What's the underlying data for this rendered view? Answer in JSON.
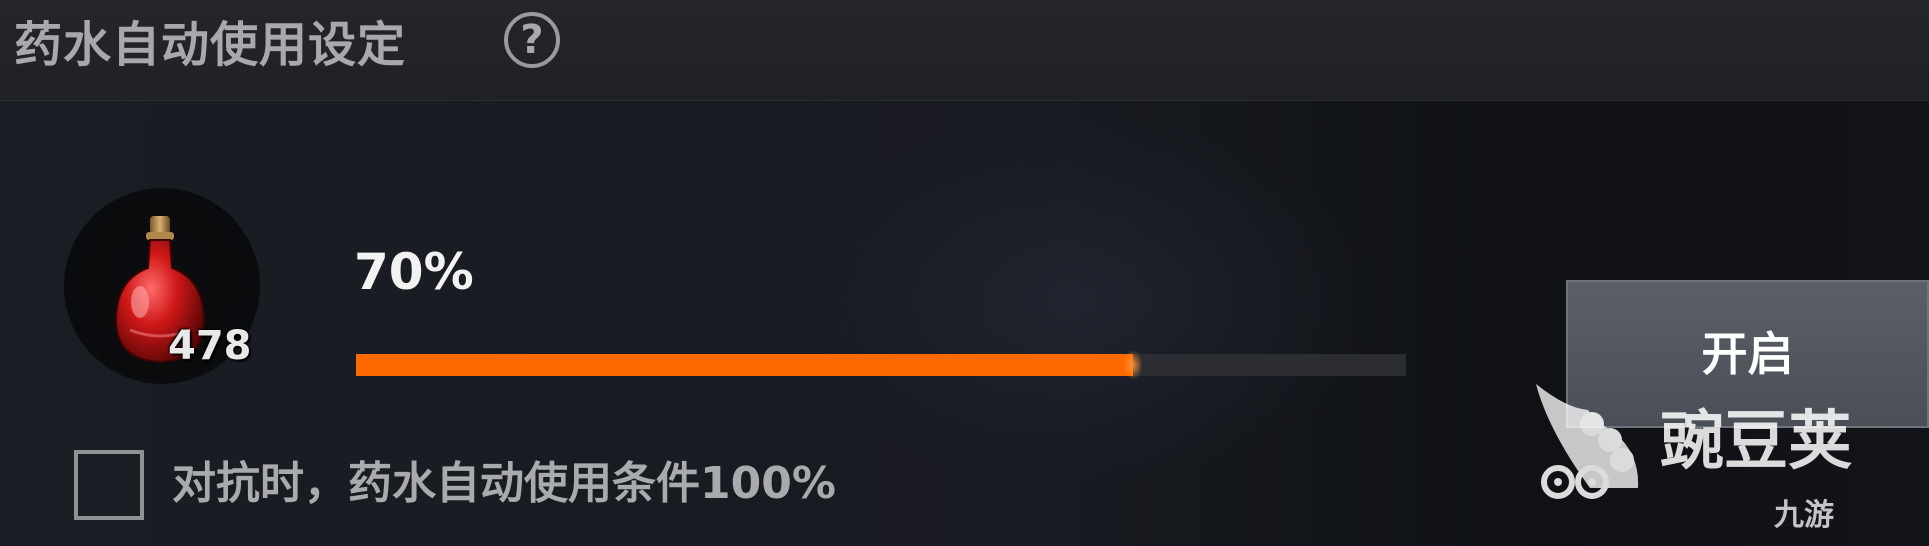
{
  "header": {
    "title": "药水自动使用设定",
    "help_icon": "question-circle-icon",
    "help_glyph": "?"
  },
  "potion": {
    "icon": "red-potion-bottle-icon",
    "count": "478"
  },
  "threshold": {
    "label": "70%",
    "fraction": 0.7,
    "fill_color": "#ff6a00",
    "track_color": "#2b2d33"
  },
  "toggle_button": {
    "label": "开启"
  },
  "pvp_option": {
    "checked": false,
    "label": "对抗时，药水自动使用条件100%"
  },
  "watermark": {
    "brand": "豌豆荚",
    "sub": "九游"
  }
}
